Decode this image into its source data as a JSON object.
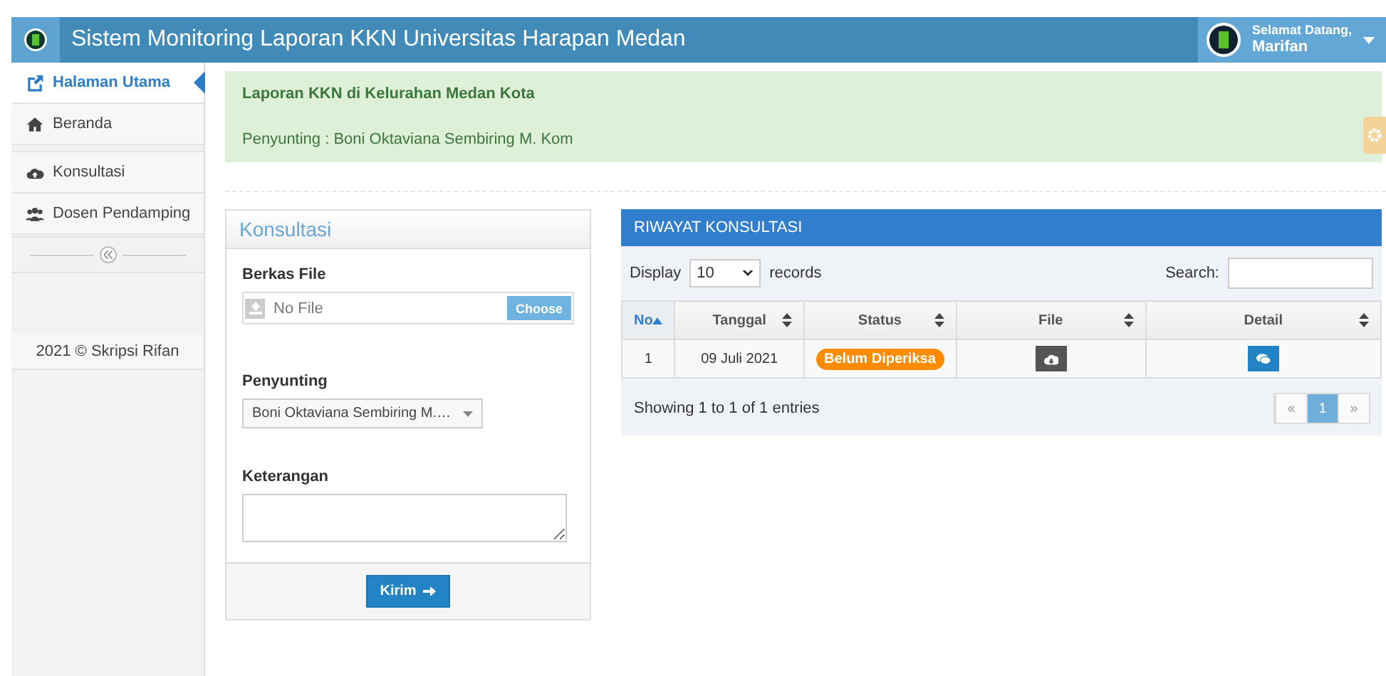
{
  "header": {
    "title": "Sistem Monitoring Laporan KKN Universitas Harapan Medan",
    "greeting": "Selamat Datang,",
    "user": "Marifan"
  },
  "sidebar": {
    "items": [
      {
        "label": "Halaman Utama",
        "selected": true
      },
      {
        "label": "Beranda",
        "selected": false
      },
      {
        "label": "Konsultasi",
        "selected": false
      },
      {
        "label": "Dosen Pendamping",
        "selected": false
      }
    ],
    "footer": "2021 © Skripsi Rifan"
  },
  "alert": {
    "title": "Laporan KKN di Kelurahan Medan Kota",
    "text": "Penyunting : Boni Oktaviana Sembiring M. Kom"
  },
  "form": {
    "title": "Konsultasi",
    "file_label": "Berkas File",
    "file_placeholder": "No File",
    "choose": "Choose",
    "editor_label": "Penyunting",
    "editor_value": "Boni Oktaviana Sembiring M.…",
    "note_label": "Keterangan",
    "submit": "Kirim"
  },
  "table": {
    "title": "RIWAYAT KONSULTASI",
    "display": "Display",
    "page_size": "10",
    "records": "records",
    "search": "Search:",
    "columns": [
      {
        "label": "No",
        "sorted": true
      },
      {
        "label": "Tanggal",
        "sorted": false
      },
      {
        "label": "Status",
        "sorted": false
      },
      {
        "label": "File",
        "sorted": false
      },
      {
        "label": "Detail",
        "sorted": false
      }
    ],
    "rows": [
      {
        "no": "1",
        "date": "09 Juli 2021",
        "status": "Belum Diperiksa"
      }
    ],
    "info": "Showing 1 to 1 of 1 entries",
    "pages": [
      {
        "label": "«",
        "selected": false
      },
      {
        "label": "1",
        "selected": true
      },
      {
        "label": "»",
        "selected": false
      }
    ]
  }
}
